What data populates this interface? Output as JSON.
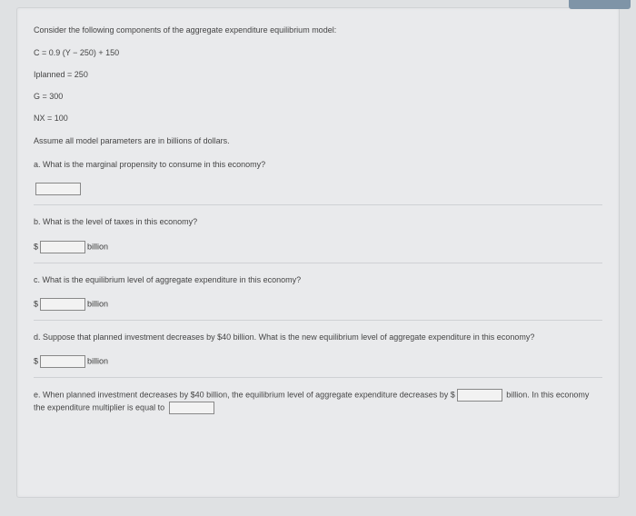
{
  "intro": "Consider the following components of the aggregate expenditure equilibrium model:",
  "eq_c": "C = 0.9 (Y − 250) + 150",
  "eq_i_label": "Iplanned",
  "eq_i_rest": " = 250",
  "eq_g": "G = 300",
  "eq_nx": "NX = 100",
  "assume": "Assume all model parameters are in billions of dollars.",
  "qa": {
    "text": "a. What is the marginal propensity to consume in this economy?"
  },
  "qb": {
    "text": "b. What is the level of taxes in this economy?",
    "prefix": "$",
    "unit": "billion"
  },
  "qc": {
    "text": "c. What is the equilibrium level of aggregate expenditure in this economy?",
    "prefix": "$",
    "unit": "billion"
  },
  "qd": {
    "text": "d. Suppose that planned investment decreases by $40 billion. What is the new equilibrium level of aggregate expenditure in this economy?",
    "prefix": "$",
    "unit": "billion"
  },
  "qe": {
    "pre": "e. When planned investment decreases by $40 billion, the equilibrium level of aggregate expenditure decreases by $",
    "mid": " billion. In this economy the expenditure multiplier is equal to "
  }
}
